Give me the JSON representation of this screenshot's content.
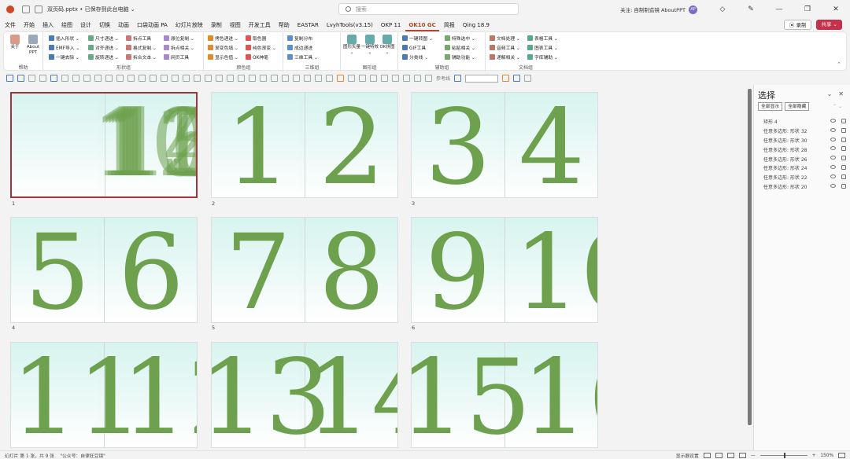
{
  "app": {
    "file_name": "双页码.pptx • 已保存到此台电脑 ⌄",
    "search_placeholder": "搜索",
    "follow_text": "关注: 自制制造镜 AboutPPT",
    "avatar_text": "AP"
  },
  "window_buttons": {
    "minimize": "—",
    "restore": "❐",
    "close": "✕"
  },
  "menu": [
    "文件",
    "开始",
    "插入",
    "绘图",
    "设计",
    "切换",
    "动画",
    "口袋动画 PA",
    "幻灯片放映",
    "录制",
    "视图",
    "开发工具",
    "帮助",
    "EASTAR",
    "LvyhTools(v3.15)",
    "OKP 11",
    "OK10 GC",
    "简报",
    "Qing 18.9"
  ],
  "menu_active": "OK10 GC",
  "record_label": "⦿ 录制",
  "share_label": "共享 ⌄",
  "ribbon": {
    "groups": [
      {
        "label": "帮助"
      },
      {
        "label": "形状组"
      },
      {
        "label": "颜色组"
      },
      {
        "label": "三维组"
      },
      {
        "label": "图形组"
      },
      {
        "label": "辅助组"
      },
      {
        "label": "文档组"
      }
    ],
    "help_items": [
      "关于",
      "About PPT"
    ],
    "shape_items": [
      "插入形状 ⌄",
      "EMF导入 ⌄",
      "一键去除 ⌄",
      "尺寸递进 ⌄",
      "对齐递进 ⌄",
      "旋转递进 ⌄",
      "拆点工具",
      "格式复制 ⌄",
      "拆合文本 ⌄",
      "原位复制 ⌄",
      "拆点相关 ⌄",
      "网页工具"
    ],
    "color_items": [
      "拷色递进 ⌄",
      "渐变色填 ⌄",
      "显示色值 ⌄",
      "取色器",
      "纯色渐变 ⌄",
      "OK神笔"
    ],
    "threed_items": [
      "复制分布",
      "成边递进",
      "三维工具 ⌄"
    ],
    "graphic_items": [
      "图形矢量 ⌄",
      "一键特效 ⌄",
      "OK拼图 ⌄",
      "图形库"
    ],
    "aux_items": [
      "一键转图 ⌄",
      "GIF工具",
      "分类线 ⌄",
      "特殊选中 ⌄",
      "粘贴相关 ⌄",
      "辅助功能 ⌄"
    ],
    "doc_items": [
      "文档处理 ⌄",
      "音频工具 ⌄",
      "递解相关 ⌄",
      "表格工具 ⌄",
      "图表工具 ⌄",
      "字库辅助 ⌄"
    ]
  },
  "qat": {
    "ref_line": "参考线"
  },
  "slides": [
    {
      "label": "1",
      "left": "",
      "right": "10 11 12 13 14 15 16",
      "overlap": [
        "10",
        "11",
        "12",
        "13",
        "14",
        "15",
        "16"
      ],
      "selected": true
    },
    {
      "label": "2",
      "left": "1",
      "right": "2"
    },
    {
      "label": "3",
      "left": "3",
      "right": "4"
    },
    {
      "label": "4",
      "left": "5",
      "right": "6"
    },
    {
      "label": "5",
      "left": "7",
      "right": "8"
    },
    {
      "label": "6",
      "left": "9",
      "right": "10"
    },
    {
      "label": "",
      "left": "11",
      "right": "12"
    },
    {
      "label": "",
      "left": "13",
      "right": "14"
    },
    {
      "label": "",
      "left": "15",
      "right": "16"
    }
  ],
  "selection_pane": {
    "title": "选择",
    "show_all": "全部显示",
    "hide_all": "全部隐藏",
    "arrows": "⌃ ⌄",
    "items": [
      "矩形 4",
      "任意多边形: 形状 32",
      "任意多边形: 形状 30",
      "任意多边形: 形状 28",
      "任意多边形: 形状 26",
      "任意多边形: 形状 24",
      "任意多边形: 形状 22",
      "任意多边形: 形状 20"
    ]
  },
  "status": {
    "slide_info": "幻灯片 第 1 张，共 9 张",
    "note": "\"公众号：自律狂豆镜\"",
    "display_settings": "显示器设置",
    "zoom": "150%"
  },
  "colors": {
    "accent": "#b7472a",
    "number_green": "#6da14d",
    "slide_top": "#d7f4ef",
    "selected_border": "#a1343c"
  }
}
